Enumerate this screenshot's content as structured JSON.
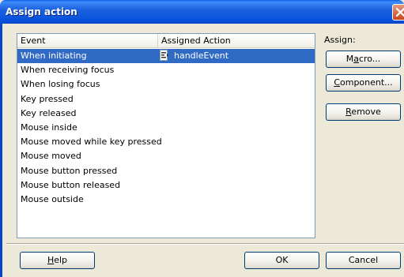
{
  "window": {
    "title": "Assign action"
  },
  "table": {
    "columns": [
      "Event",
      "Assigned Action"
    ],
    "rows": [
      {
        "event": "When initiating",
        "action": "handleEvent",
        "selected": true
      },
      {
        "event": "When receiving focus",
        "action": ""
      },
      {
        "event": "When losing focus",
        "action": ""
      },
      {
        "event": "Key pressed",
        "action": ""
      },
      {
        "event": "Key released",
        "action": ""
      },
      {
        "event": "Mouse inside",
        "action": ""
      },
      {
        "event": "Mouse moved while key pressed",
        "action": ""
      },
      {
        "event": "Mouse moved",
        "action": ""
      },
      {
        "event": "Mouse button pressed",
        "action": ""
      },
      {
        "event": "Mouse button released",
        "action": ""
      },
      {
        "event": "Mouse outside",
        "action": ""
      }
    ]
  },
  "assign": {
    "label": "Assign:",
    "macro_label": "Macro...",
    "component_label": "Component...",
    "remove_label": "Remove"
  },
  "footer": {
    "help_label": "Help",
    "ok_label": "OK",
    "cancel_label": "Cancel"
  },
  "colors": {
    "selection": "#316ac5",
    "titlebar": "#0a5fe8"
  }
}
